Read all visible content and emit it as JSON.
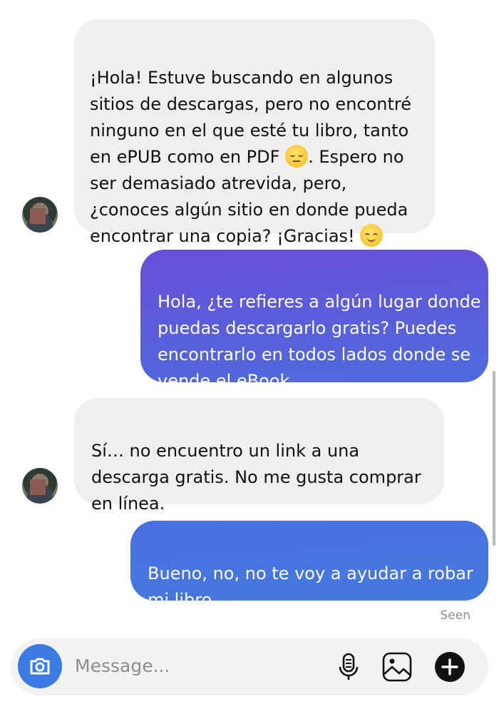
{
  "messages": [
    {
      "id": "m1",
      "direction": "incoming",
      "text_a": "¡Hola! Estuve buscando en algunos sitios de descargas, pero no encontré ninguno en el que esté tu libro, tanto en ePUB como en PDF ",
      "emoji_1": "pensive-face",
      "text_b": ". Espero no ser demasiado atrevida, pero, ¿conoces algún sitio en donde pueda encontrar una copia? ¡Gracias! ",
      "emoji_2": "smiling-face"
    },
    {
      "id": "m2",
      "direction": "outgoing",
      "text": "Hola, ¿te refieres a algún lugar donde puedas descargarlo gratis? Puedes encontrarlo en todos lados donde se vende el eBook."
    },
    {
      "id": "m3",
      "direction": "incoming",
      "text": "Sí… no encuentro un link a una descarga gratis. No me gusta comprar en línea."
    },
    {
      "id": "m4",
      "direction": "outgoing",
      "text": "Bueno, no, no te voy a ayudar a robar mi libro."
    }
  ],
  "seen_label": "Seen",
  "composer": {
    "placeholder": "Message...",
    "icons": [
      "camera-icon",
      "microphone-icon",
      "gallery-icon",
      "plus-icon"
    ]
  },
  "colors": {
    "incoming_bubble": "#efefef",
    "outgoing_gradient_start": "#6a4fd9",
    "outgoing_gradient_end": "#4479df",
    "camera_button": "#3b7be3"
  }
}
